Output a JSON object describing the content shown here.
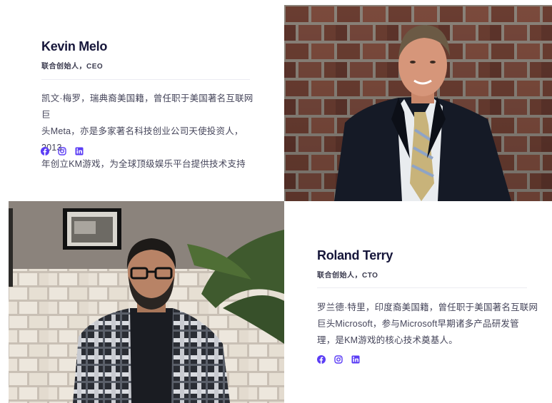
{
  "members": [
    {
      "name": "Kevin Melo",
      "role": "联合创始人，CEO",
      "bio_lines": [
        "凯文·梅罗，瑞典裔美国籍，曾任职于美国著名互联网巨",
        "头Meta，亦是多家著名科技创业公司天使投资人，2013",
        "年创立KM游戏，为全球顶级娱乐平台提供技术支持"
      ],
      "social_icons": [
        "facebook-icon",
        "instagram-icon",
        "linkedin-icon"
      ]
    },
    {
      "name": "Roland Terry",
      "role": "联合创始人，CTO",
      "bio_lines": [
        "罗兰德·特里，印度裔美国籍，曾任职于美国著名互联网",
        "巨头Microsoft，参与Microsoft早期诸多产品研发管",
        "理，是KM游戏的核心技术奠基人。"
      ],
      "social_icons": [
        "facebook-icon",
        "instagram-icon",
        "linkedin-icon"
      ]
    }
  ],
  "colors": {
    "accent": "#5b3df5",
    "name_text": "#16163a",
    "body_text": "#45455a",
    "divider": "#ececf2"
  }
}
